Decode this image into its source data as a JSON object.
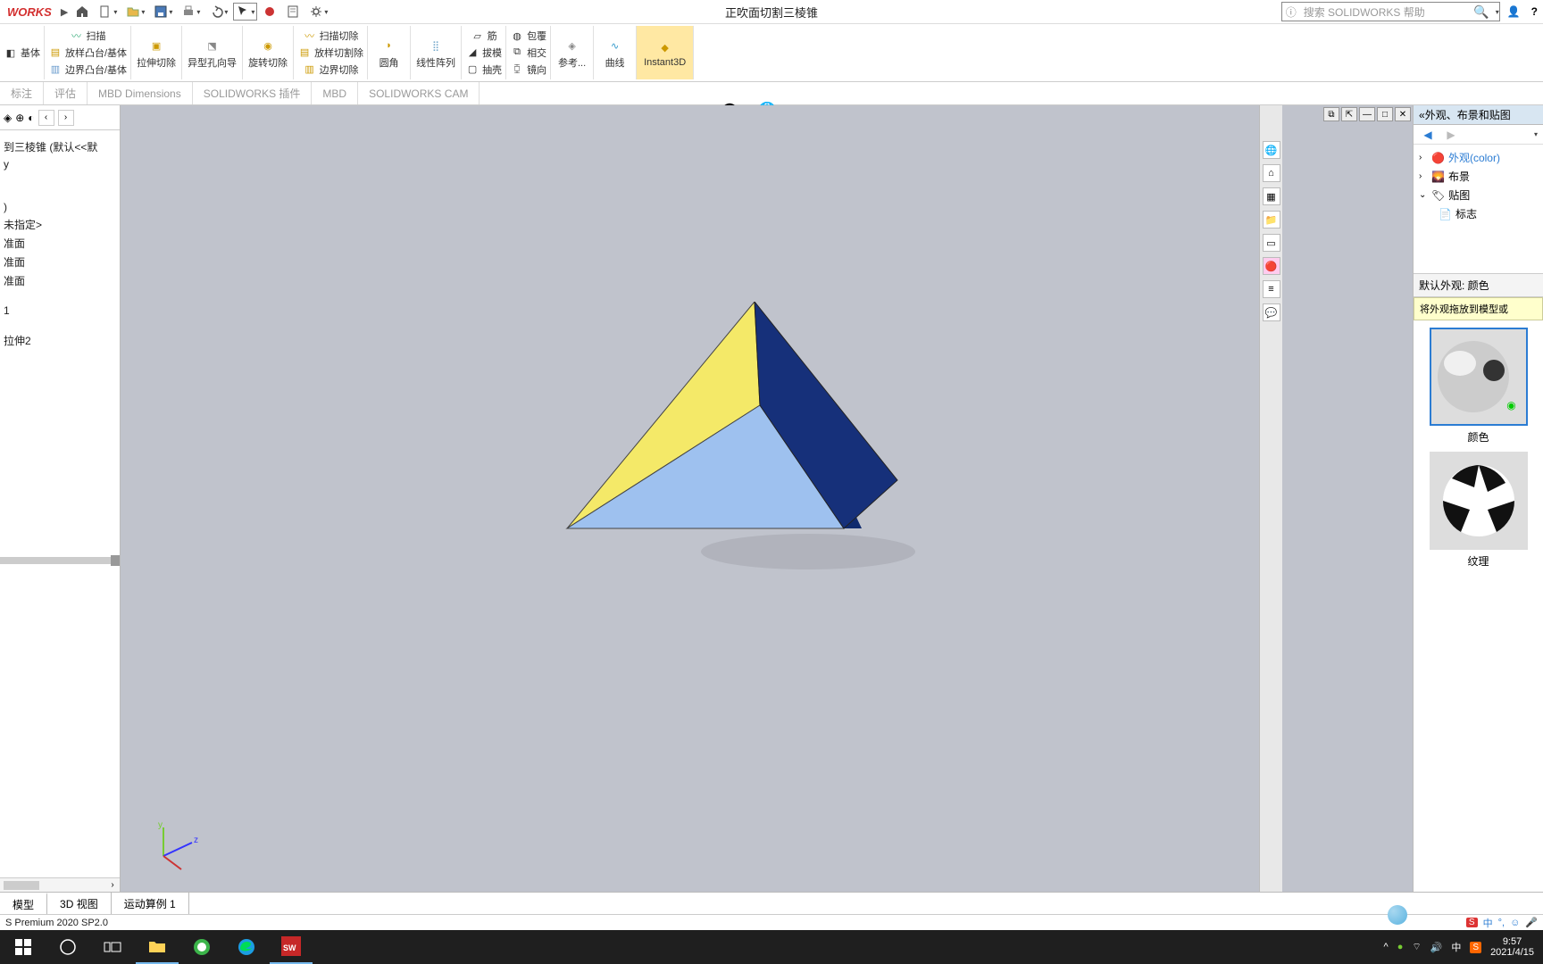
{
  "app": {
    "logo": "WORKS",
    "title": "正吹面切割三棱锥"
  },
  "search": {
    "placeholder": "搜索 SOLIDWORKS 帮助"
  },
  "ribbon": {
    "sweep": "扫描",
    "loft": "放样凸台/基体",
    "boundary": "边界凸台/基体",
    "extrude_cut": "拉伸切除",
    "wizard": "异型孔向导",
    "revolve_cut": "旋转切除",
    "sweep_cut": "扫描切除",
    "loft_cut": "放样切割除",
    "boundary_cut": "边界切除",
    "fillet": "圆角",
    "pattern": "线性阵列",
    "rib": "筋",
    "wrap": "包覆",
    "draft": "拔模",
    "intersect": "相交",
    "shell": "抽壳",
    "mirror": "镜向",
    "ref": "参考...",
    "curve": "曲线",
    "instant": "Instant3D",
    "base": "基体"
  },
  "tabs": [
    "标注",
    "评估",
    "MBD Dimensions",
    "SOLIDWORKS 插件",
    "MBD",
    "SOLIDWORKS CAM"
  ],
  "tree": {
    "root": "到三棱锥  (默认<<默",
    "n1": "未指定>",
    "n2": "准面",
    "n3": "准面",
    "n4": "准面",
    "n5": "1",
    "n6": "拉伸2"
  },
  "rightpanel": {
    "title": "外观、布景和贴图",
    "appearance": "外观(color)",
    "scene": "布景",
    "decal": "贴图",
    "mark": "标志",
    "default_label": "默认外观: 颜色",
    "hint": "将外观拖放到模型或",
    "sw1": "颜色",
    "sw2": "纹理"
  },
  "bottomtabs": {
    "t1": "模型",
    "t2": "3D 视图",
    "t3": "运动算例 1"
  },
  "status": {
    "version": "S Premium 2020 SP2.0",
    "ime": "中"
  },
  "taskbar": {
    "time": "9:57",
    "date": "2021/4/15",
    "ime": "中"
  }
}
